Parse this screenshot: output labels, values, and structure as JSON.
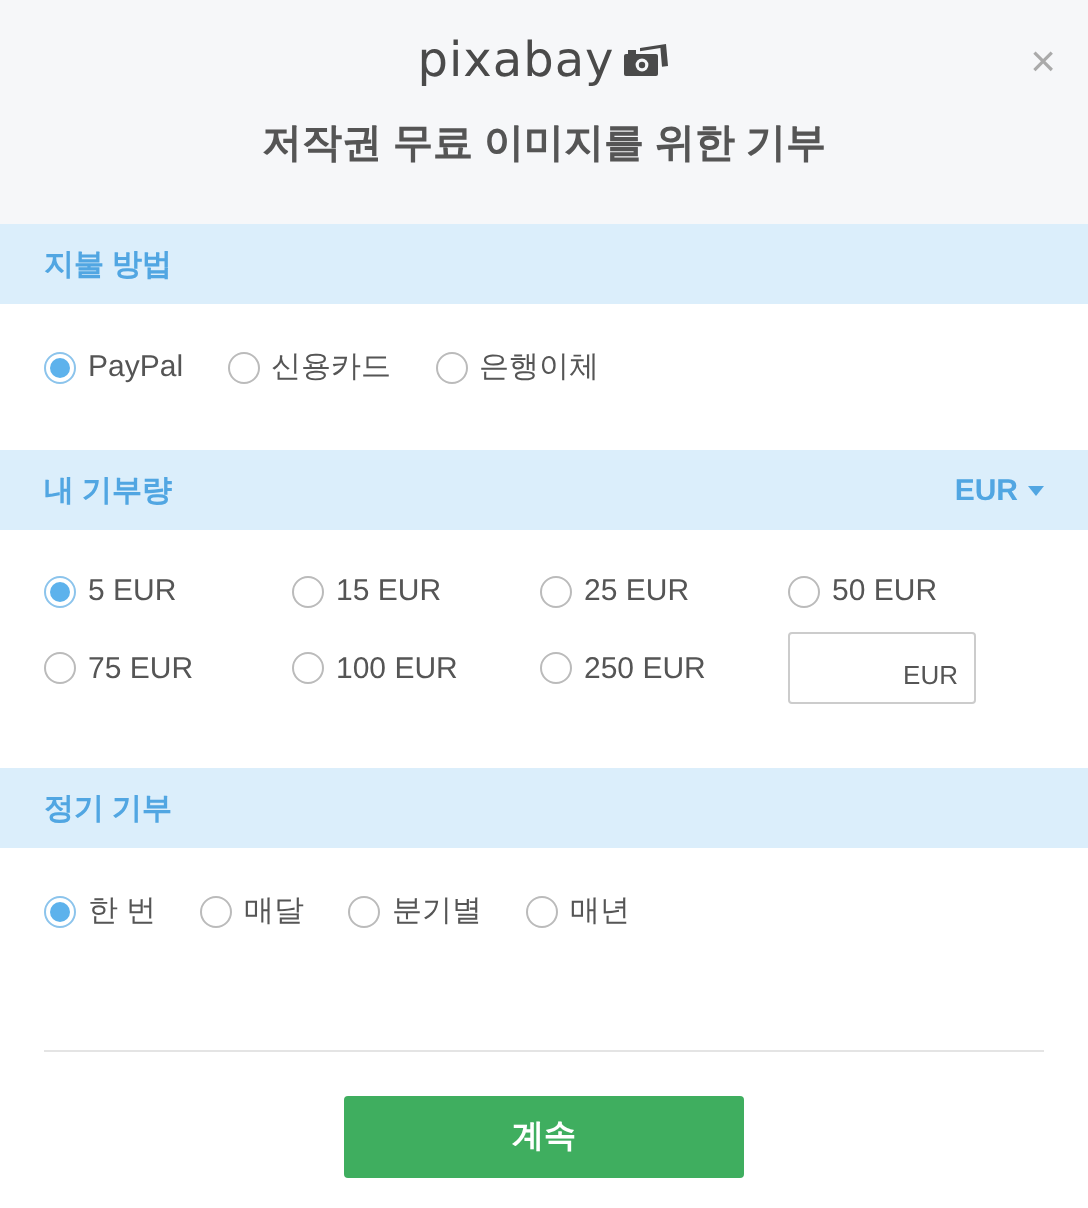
{
  "header": {
    "logo": "pixabay",
    "title": "저작권 무료 이미지를 위한 기부",
    "close": "×"
  },
  "sections": [
    {
      "kind": "payment",
      "title": "지불 방법",
      "options": [
        {
          "label": "PayPal",
          "selected": true
        },
        {
          "label": "신용카드",
          "selected": false
        },
        {
          "label": "은행이체",
          "selected": false
        }
      ]
    },
    {
      "kind": "amount",
      "title": "내 기부량",
      "currency": "EUR",
      "options": [
        {
          "label": "5 EUR",
          "selected": true
        },
        {
          "label": "15 EUR",
          "selected": false
        },
        {
          "label": "25 EUR",
          "selected": false
        },
        {
          "label": "50 EUR",
          "selected": false
        },
        {
          "label": "75 EUR",
          "selected": false
        },
        {
          "label": "100 EUR",
          "selected": false
        },
        {
          "label": "250 EUR",
          "selected": false
        }
      ],
      "custom_amount": {
        "placeholder": "EUR"
      }
    },
    {
      "kind": "frequency",
      "title": "정기 기부",
      "options": [
        {
          "label": "한 번",
          "selected": true
        },
        {
          "label": "매달",
          "selected": false
        },
        {
          "label": "분기별",
          "selected": false
        },
        {
          "label": "매년",
          "selected": false
        }
      ]
    }
  ],
  "continue_button": "계속"
}
